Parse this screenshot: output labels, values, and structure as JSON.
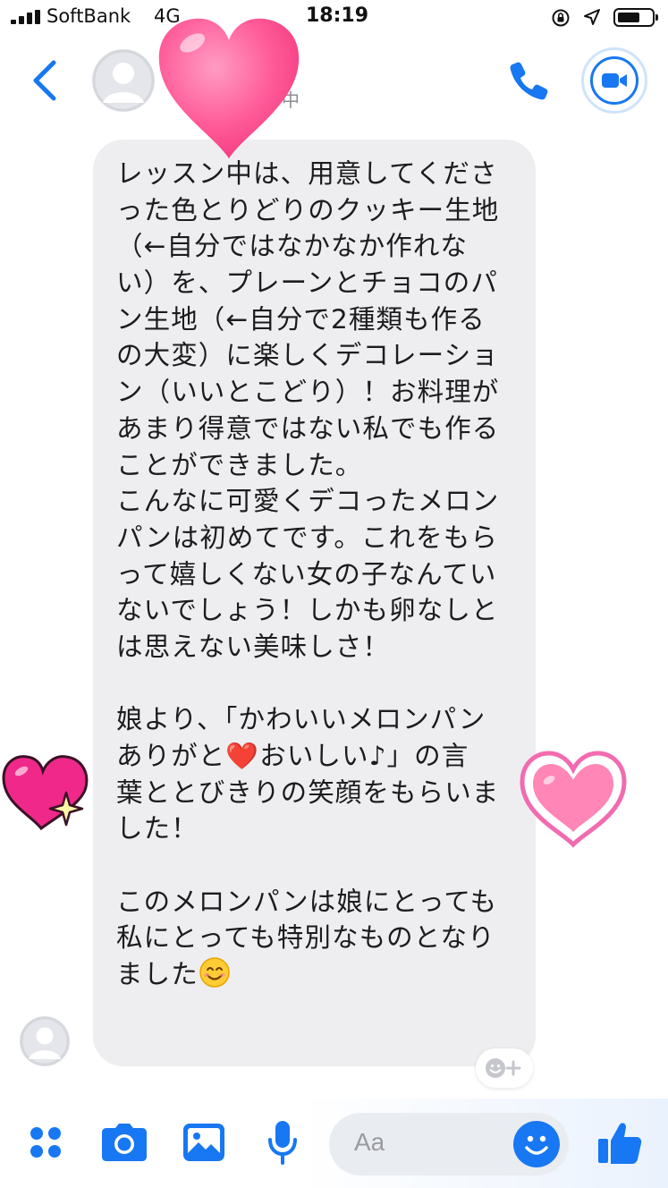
{
  "status_bar": {
    "carrier": "SoftBank",
    "network": "4G",
    "time": "18:19"
  },
  "header": {
    "contact_status": "中",
    "icons": [
      "back-icon",
      "avatar",
      "phone-icon",
      "video-camera-icon"
    ]
  },
  "message": {
    "lines": [
      "レッスン中は、用意してくださ",
      "った色とりどりのクッキー生地",
      "（←自分ではなかなか作れな",
      "い）を、プレーンとチョコのパ",
      "ン生地（←自分で2種類も作る",
      "の大変）に楽しくデコレーショ",
      "ン（いいとこどり）！お料理が",
      "あまり得意ではない私でも作る",
      "ことができました。",
      "こんなに可愛くデコったメロン",
      "パンは初めてです。これをもら",
      "って嬉しくない女の子なんてい",
      "ないでしょう！しかも卵なしと",
      "は思えない美味しさ！",
      "",
      "娘より、「かわいいメロンパン",
      "ありがと❤️おいしい♪」の言",
      "葉ととびきりの笑顔をもらいま",
      "した！",
      "",
      "このメロンパンは娘にとっても",
      "私にとっても特別なものとなり"
    ],
    "last_line": "ました",
    "last_line_emoji": "smiling-face-emoji"
  },
  "stickers": [
    "pink-heart-sticker",
    "heart-sparkle-sticker",
    "outlined-heart-sticker"
  ],
  "composer": {
    "placeholder": "Aa",
    "icons": [
      "menu-dots-icon",
      "camera-icon",
      "gallery-icon",
      "microphone-icon",
      "emoji-icon",
      "thumbs-up-icon"
    ]
  },
  "colors": {
    "accent": "#1877f2",
    "bubble": "#eeeef0",
    "heart_pink": "#ff5c9a",
    "heart_magenta": "#f0288a"
  }
}
